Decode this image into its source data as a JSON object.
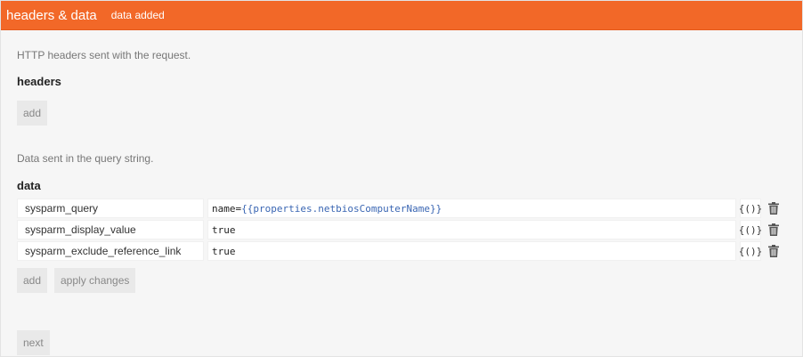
{
  "header": {
    "title": "headers & data",
    "badge": "data added"
  },
  "headers_section": {
    "description": "HTTP headers sent with the request.",
    "title": "headers",
    "add_label": "add"
  },
  "data_section": {
    "description": "Data sent in the query string.",
    "title": "data",
    "rows": [
      {
        "key": "sysparm_query",
        "value_prefix": "name=",
        "value_template": "{{properties.netbiosComputerName}}",
        "var_label": "{()}"
      },
      {
        "key": "sysparm_display_value",
        "value_prefix": "true",
        "value_template": "",
        "var_label": "{()}"
      },
      {
        "key": "sysparm_exclude_reference_link",
        "value_prefix": "true",
        "value_template": "",
        "var_label": "{()}"
      }
    ],
    "add_label": "add",
    "apply_label": "apply changes"
  },
  "footer": {
    "next_label": "next"
  },
  "icons": {
    "delete": "trash-icon"
  },
  "colors": {
    "header_bg": "#f26828",
    "template_text": "#3a66b3"
  }
}
